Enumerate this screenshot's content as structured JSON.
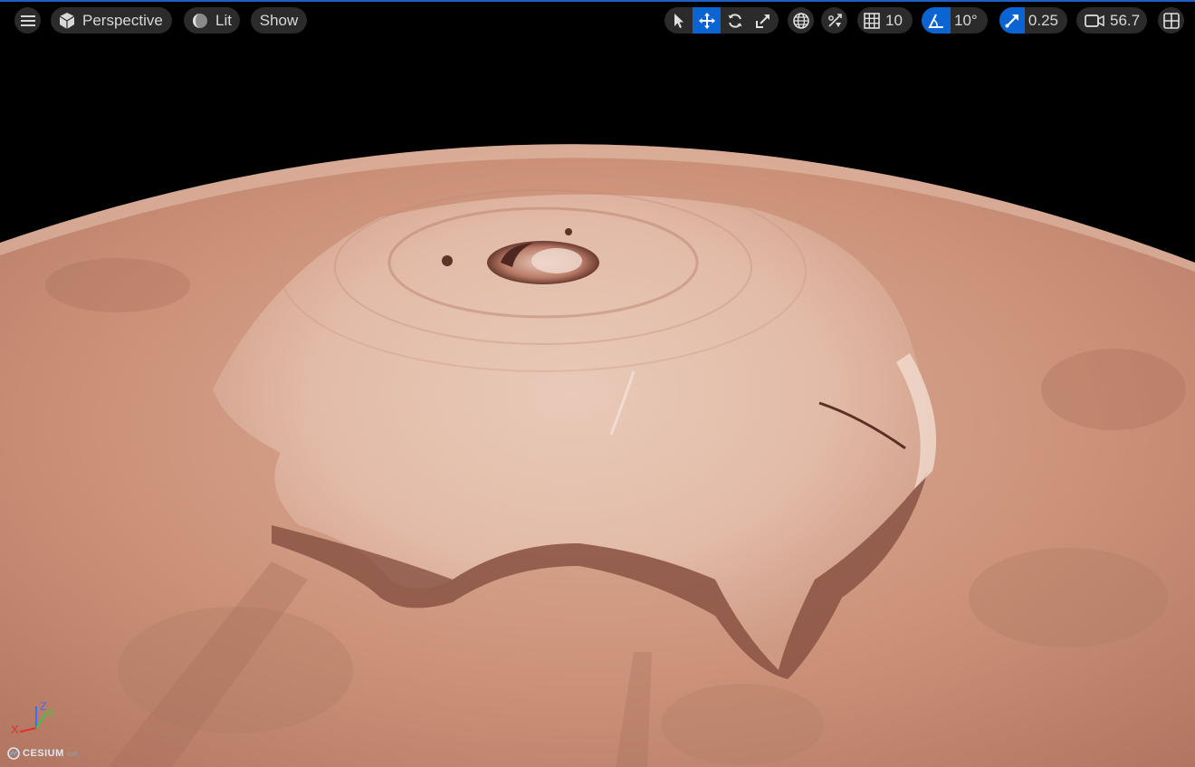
{
  "toolbar": {
    "menu_icon": "hamburger-menu-icon",
    "perspective": {
      "label": "Perspective",
      "icon": "cube-icon"
    },
    "lit": {
      "label": "Lit",
      "icon": "sphere-shading-icon"
    },
    "show": {
      "label": "Show"
    },
    "transform_tools": [
      {
        "name": "select",
        "icon": "cursor-arrow-icon",
        "active": false
      },
      {
        "name": "translate",
        "icon": "move-arrows-icon",
        "active": true
      },
      {
        "name": "rotate",
        "icon": "rotate-icon",
        "active": false
      },
      {
        "name": "scale",
        "icon": "scale-icon",
        "active": false
      }
    ],
    "world_local_icon": "globe-icon",
    "surface_snap_icon": "surface-snap-icon",
    "grid_snap": {
      "icon": "grid-icon",
      "value": "10"
    },
    "rotation_snap": {
      "icon": "angle-icon",
      "value": "10°"
    },
    "scale_snap": {
      "icon": "scale-snap-icon",
      "value": "0.25"
    },
    "camera_speed": {
      "icon": "video-camera-icon",
      "value": "56.7"
    },
    "layout_icon": "viewport-layout-icon"
  },
  "axis_indicator": {
    "x": "X",
    "y": "Y",
    "z": "Z"
  },
  "attribution": {
    "brand": "CESIUM",
    "suffix": "ion"
  },
  "colors": {
    "accent_blue": "#0a64d2",
    "toolbar_pill": "#2b2b2b",
    "mars_surface": "#c98f77",
    "space": "#000000"
  }
}
